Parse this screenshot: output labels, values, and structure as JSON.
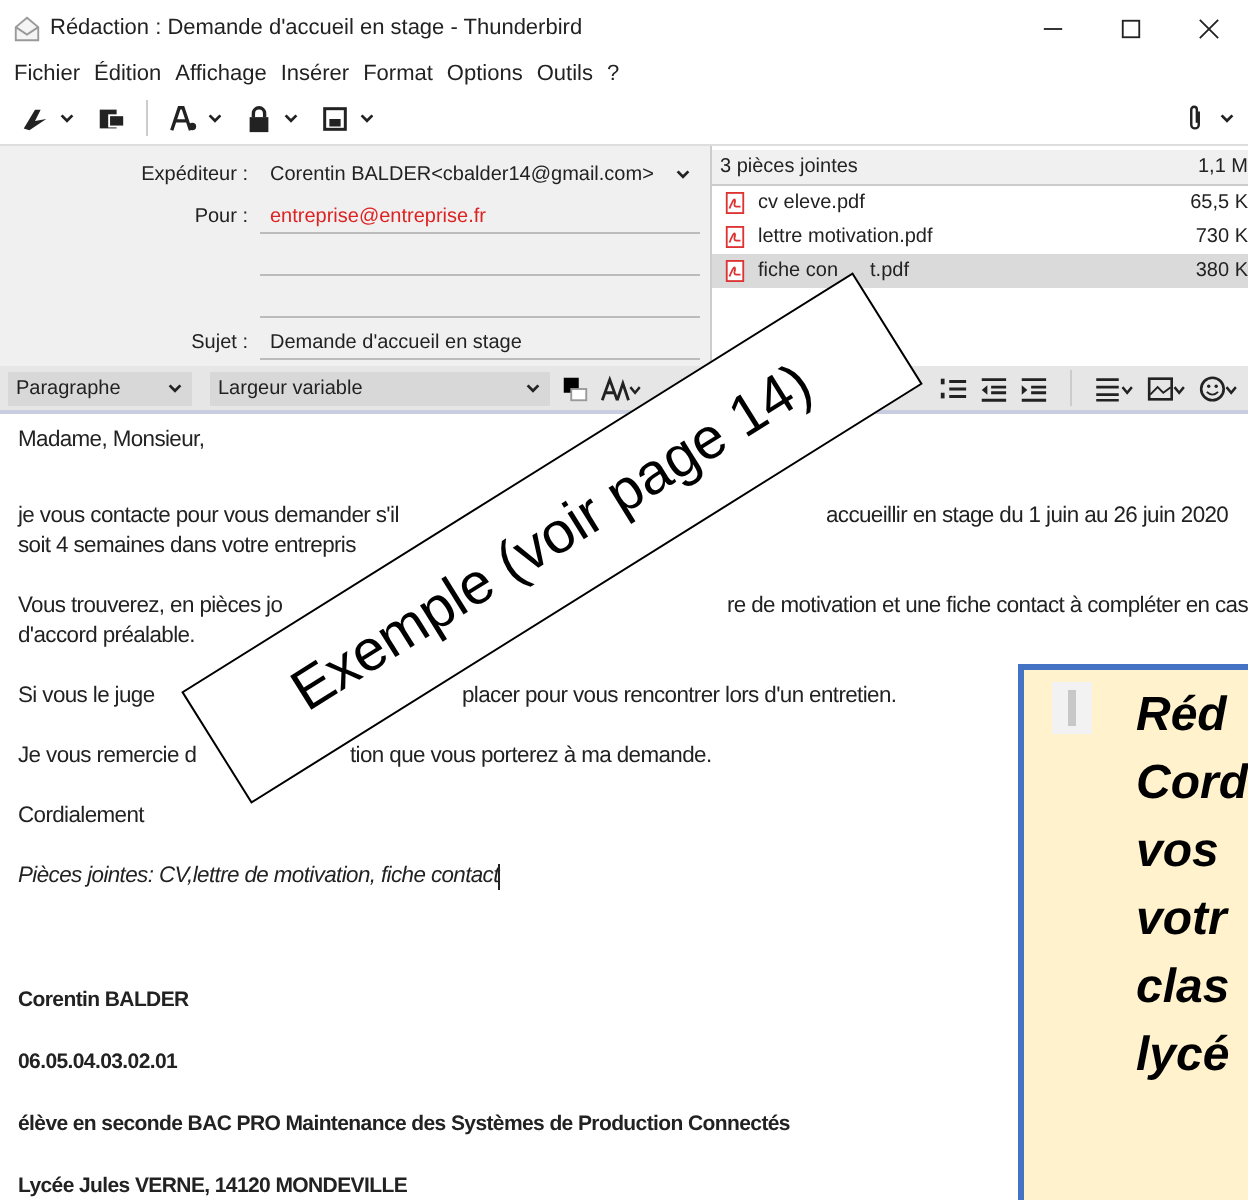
{
  "window": {
    "title": "Rédaction : Demande d'accueil en stage - Thunderbird"
  },
  "menu": [
    "Fichier",
    "Édition",
    "Affichage",
    "Insérer",
    "Format",
    "Options",
    "Outils",
    "?"
  ],
  "header_fields": [
    {
      "label": "Expéditeur :",
      "value": "Corentin BALDER<cbalder14@gmail.com>",
      "kind": "dropdown"
    },
    {
      "label": "Pour :",
      "value": "entreprise@entreprise.fr",
      "kind": "recipient"
    },
    {
      "kind": "blank"
    },
    {
      "kind": "blank"
    },
    {
      "label": "Sujet :",
      "value": "Demande d'accueil en stage",
      "kind": "text"
    }
  ],
  "attachments": {
    "count": "3 pièces jointes",
    "total": "1,1 M",
    "items": [
      {
        "name": "cv eleve.pdf",
        "size": "65,5 K",
        "selected": false
      },
      {
        "name": "lettre motivation.pdf",
        "size": "730 K",
        "selected": false
      },
      {
        "name": "fiche con",
        "name_tail": "t.pdf",
        "size": "380 K",
        "selected": true
      }
    ]
  },
  "format_bar": {
    "paragraph": "Paragraphe",
    "font": "Largeur variable"
  },
  "body": [
    {
      "kind": "text",
      "lines": [
        [
          "Madame, Monsieur,"
        ]
      ]
    },
    {
      "kind": "text",
      "lines": [
        [
          "je vous contacte pour vous demander s'il",
          "accueillir en stage  du 1 juin au 26 juin 2020"
        ],
        [
          "soit  4 semaines dans votre entrepris"
        ]
      ]
    },
    {
      "kind": "text",
      "lines": [
        [
          "Vous trouverez, en pièces jo",
          "re de motivation et une fiche contact à compléter en cas"
        ],
        [
          "d'accord préalable."
        ]
      ]
    },
    {
      "kind": "text",
      "lines": [
        [
          "Si vous le  juge",
          "placer pour vous rencontrer lors d'un entretien."
        ]
      ]
    },
    {
      "kind": "text",
      "lines": [
        [
          "Je vous remercie d",
          "tion que vous porterez à ma demande."
        ]
      ]
    },
    {
      "kind": "text",
      "lines": [
        [
          "Cordialement"
        ]
      ]
    },
    {
      "kind": "italic",
      "lines": [
        [
          "Pièces jointes: CV,lettre de motivation, fiche contact"
        ]
      ]
    },
    {
      "kind": "bold",
      "lines": [
        [
          "Corentin BALDER"
        ]
      ]
    },
    {
      "kind": "bold",
      "lines": [
        [
          "06.05.04.03.02.01"
        ]
      ]
    },
    {
      "kind": "bold",
      "lines": [
        [
          "élève en seconde BAC PRO Maintenance des Systèmes de Production Connectés"
        ]
      ]
    },
    {
      "kind": "bold",
      "lines": [
        [
          "Lycée Jules VERNE, 14120 MONDEVILLE"
        ]
      ]
    }
  ],
  "stamp": "Exemple (voir page 14)",
  "note": [
    "Réd",
    "Cord",
    "vos",
    "votr",
    "clas",
    "lycé"
  ]
}
